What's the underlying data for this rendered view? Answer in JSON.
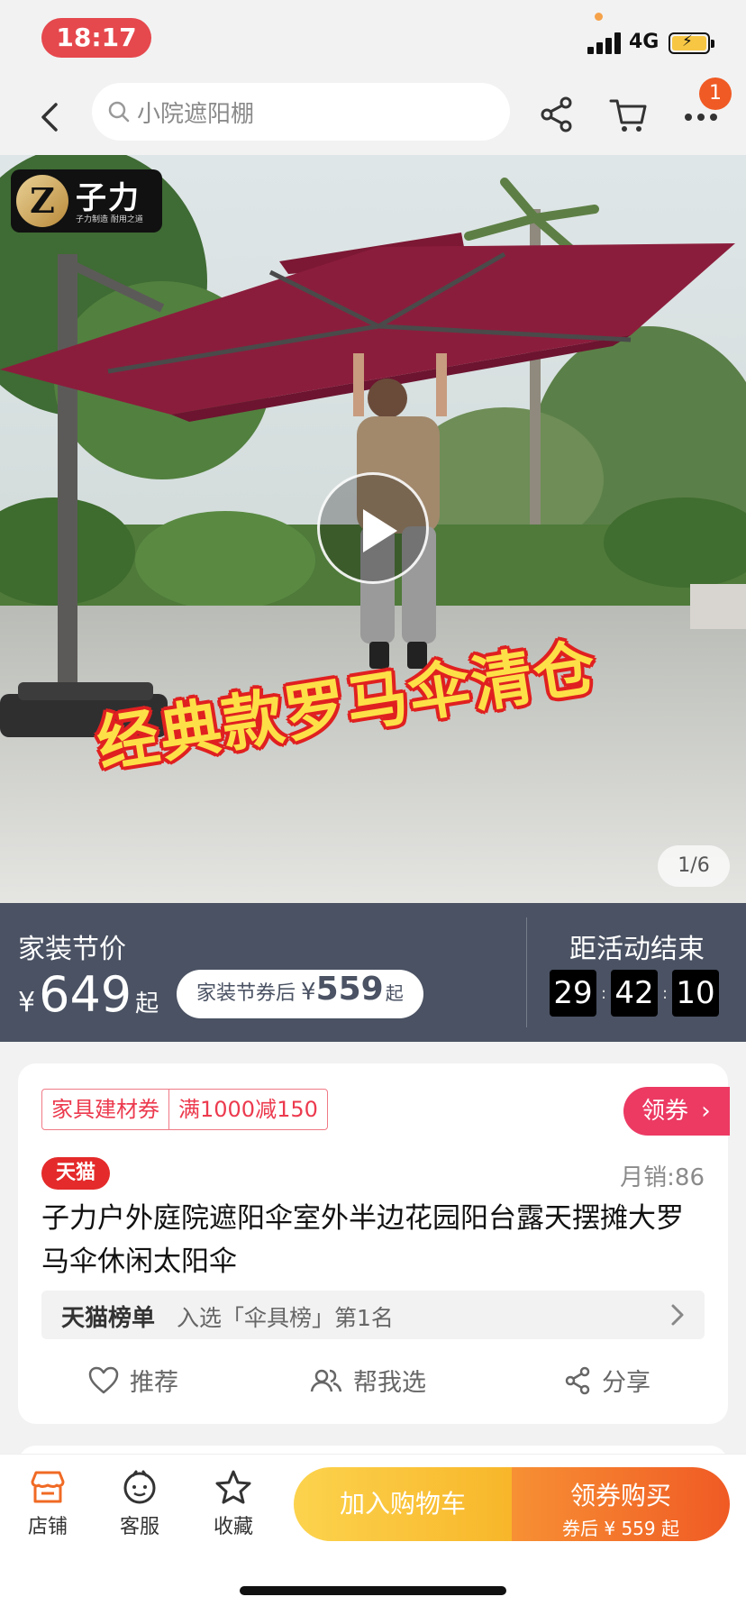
{
  "status_bar": {
    "time": "18:17",
    "network": "4G"
  },
  "nav": {
    "search_placeholder": "小院遮阳棚",
    "notification_count": "1"
  },
  "hero": {
    "brand_name": "子力",
    "brand_tagline": "子力制造  耐用之道",
    "promo_text": "经典款罗马伞清仓",
    "pager": "1/6"
  },
  "price_band": {
    "title": "家装节价",
    "currency": "¥",
    "price": "649",
    "price_suffix": "起",
    "coupon_label": "家装节券后",
    "coupon_currency": "¥",
    "coupon_price": "559",
    "coupon_suffix": "起",
    "countdown_label": "距活动结束",
    "countdown": {
      "h": "29",
      "m": "42",
      "s": "10"
    }
  },
  "card": {
    "coupon_tag_name": "家具建材券",
    "coupon_tag_rule": "满1000减150",
    "claim_label": "领券",
    "platform_badge": "天猫",
    "monthly_sales": "月销:86",
    "product_title": "子力户外庭院遮阳伞室外半边花园阳台露天摆摊大罗马伞休闲太阳伞",
    "rank_brand": "天猫榜单",
    "rank_text": "入选「伞具榜」第1名",
    "actions": {
      "recommend": "推荐",
      "help_choose": "帮我选",
      "share": "分享"
    }
  },
  "bottom_bar": {
    "store": "店铺",
    "service": "客服",
    "favorite": "收藏",
    "add_to_cart": "加入购物车",
    "buy_label": "领券购买",
    "buy_sub": "券后 ¥ 559 起"
  },
  "colors": {
    "accent_red": "#ec3a4e",
    "price_band_bg": "#4a5263",
    "cart_button": "#f8b62a",
    "buy_button": "#f05a24",
    "umbrella": "#8b1d3c"
  }
}
